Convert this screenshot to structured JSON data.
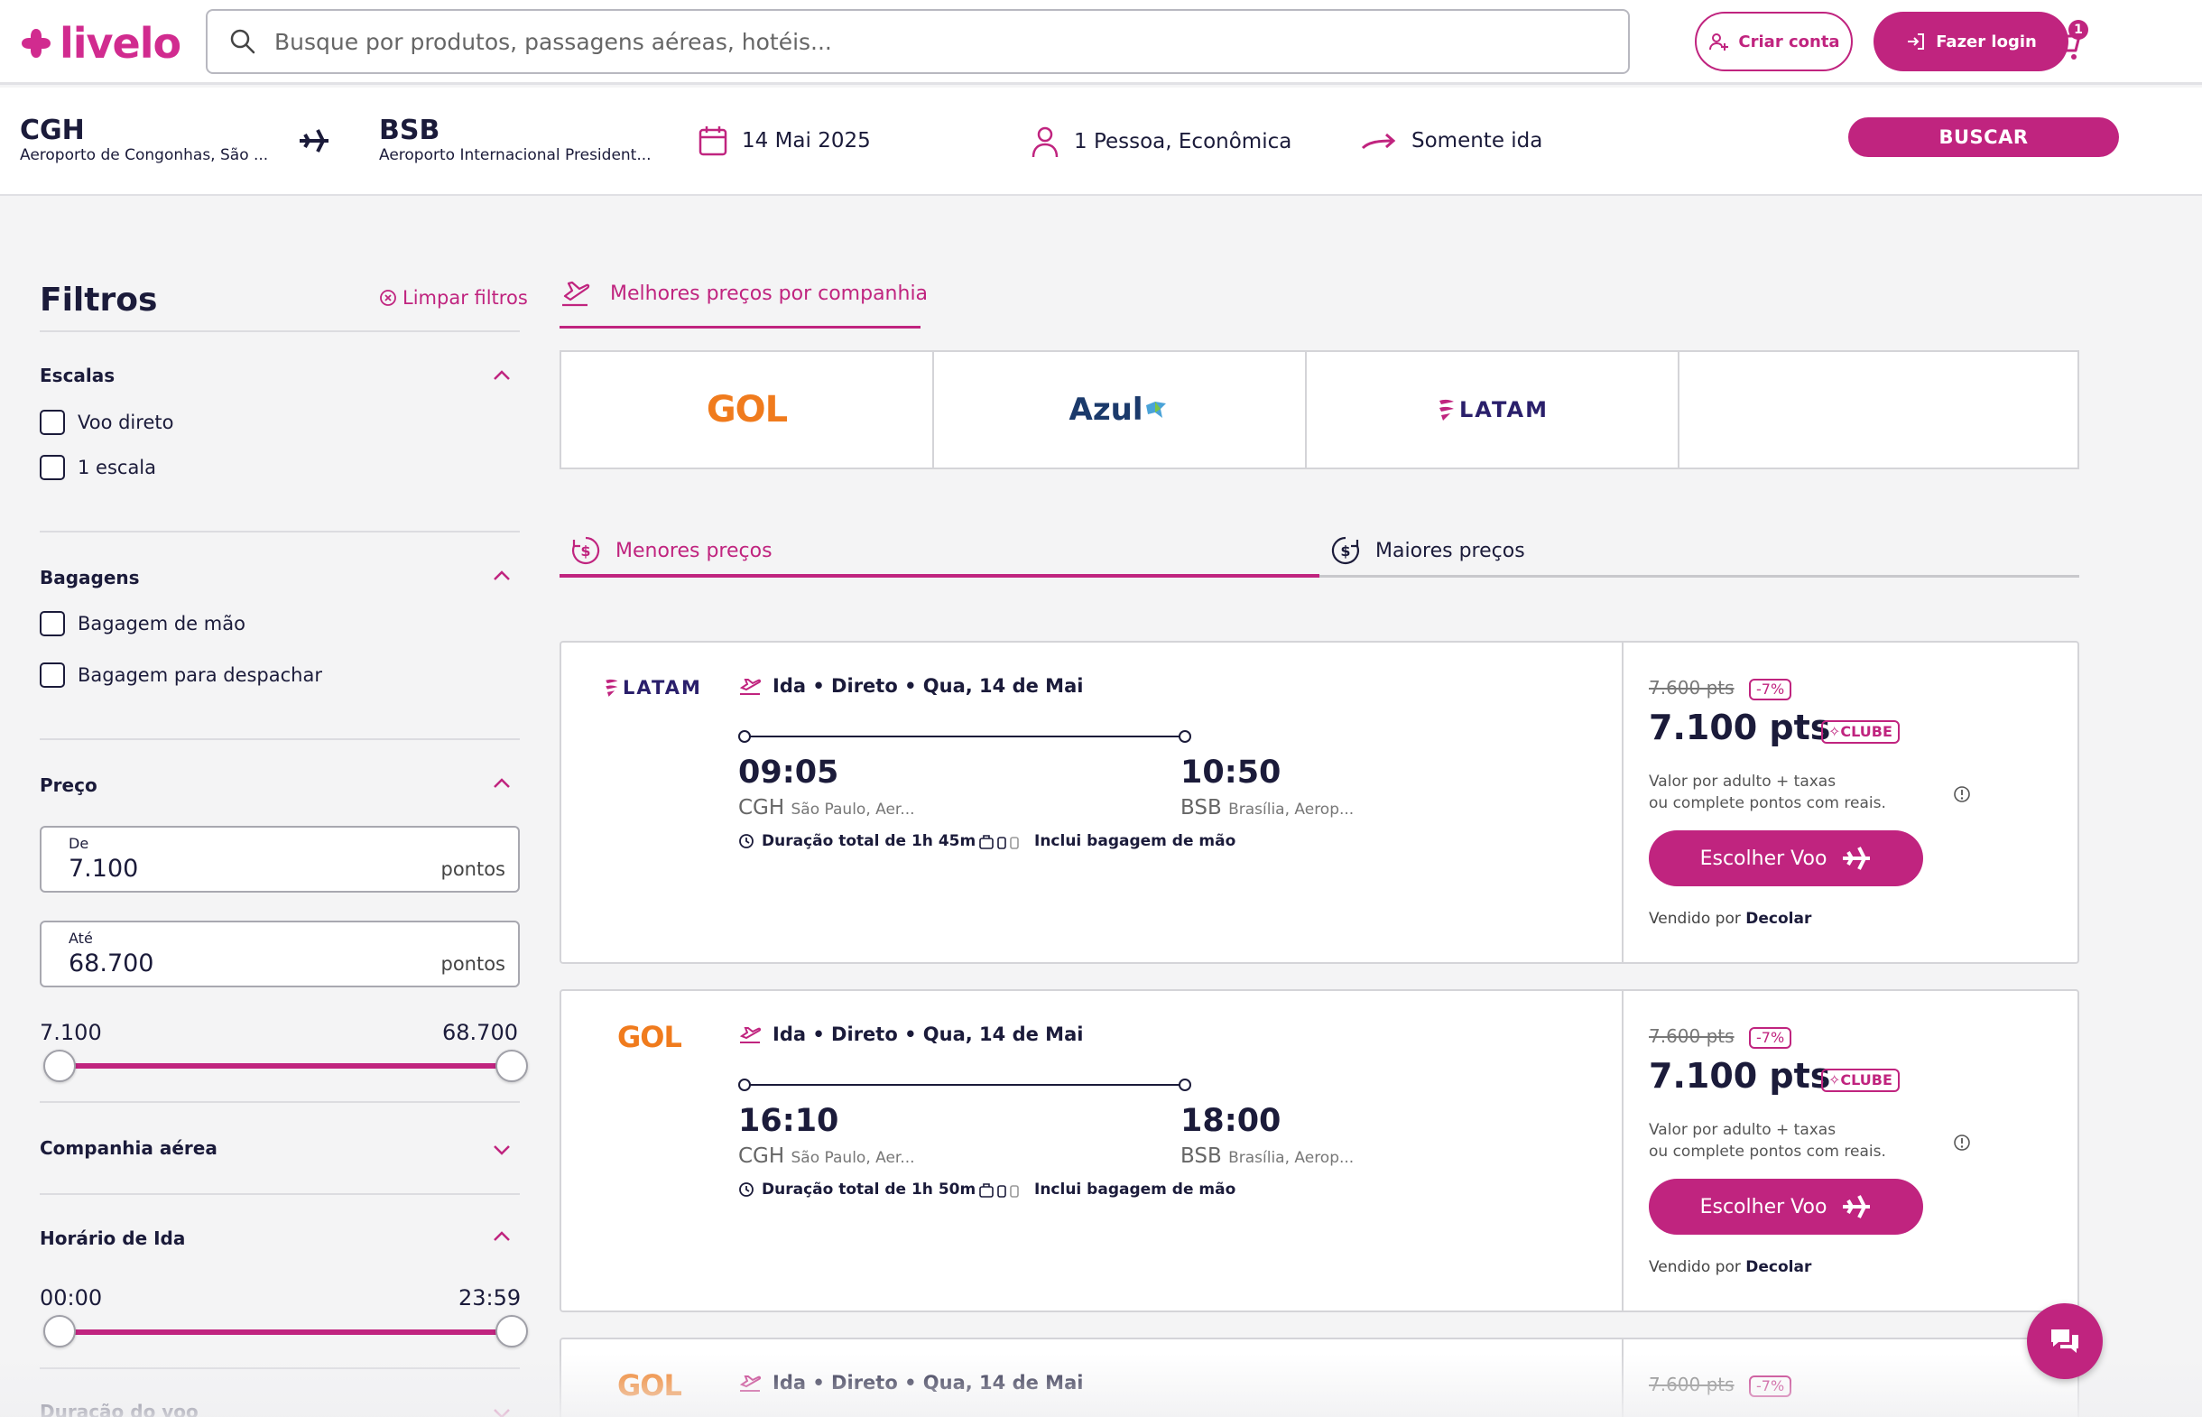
{
  "header": {
    "logo_text": "livelo",
    "search_placeholder": "Busque por produtos, passagens aéreas, hotéis...",
    "create_account": "Criar conta",
    "login": "Fazer login",
    "cart_count": "1"
  },
  "route": {
    "origin_code": "CGH",
    "origin_name": "Aeroporto de Congonhas, São ...",
    "dest_code": "BSB",
    "dest_name": "Aeroporto Internacional President...",
    "date": "14 Mai 2025",
    "passengers": "1 Pessoa, Econômica",
    "trip_type": "Somente ida",
    "search_button": "BUSCAR"
  },
  "filters": {
    "title": "Filtros",
    "clear": "Limpar filtros",
    "stops": {
      "title": "Escalas",
      "options": [
        "Voo direto",
        "1 escala"
      ]
    },
    "baggage": {
      "title": "Bagagens",
      "options": [
        "Bagagem de mão",
        "Bagagem para despachar"
      ]
    },
    "price": {
      "title": "Preço",
      "from_label": "De",
      "from_value": "7.100",
      "to_label": "Até",
      "to_value": "68.700",
      "unit": "pontos",
      "range_min": "7.100",
      "range_max": "68.700"
    },
    "airline": {
      "title": "Companhia aérea"
    },
    "departure_time": {
      "title": "Horário de Ida",
      "min": "00:00",
      "max": "23:59"
    },
    "duration": {
      "title": "Duração do voo"
    }
  },
  "main": {
    "best_prices_tab": "Melhores preços por companhia",
    "airlines": [
      "GOL",
      "Azul",
      "LATAM"
    ],
    "sort_tabs": [
      "Menores preços",
      "Maiores preços"
    ],
    "flights": [
      {
        "airline": "LATAM",
        "header": "Ida • Direto • Qua, 14 de Mai",
        "dep_time": "09:05",
        "dep_code": "CGH",
        "dep_city": "São Paulo, Aer...",
        "arr_time": "10:50",
        "arr_code": "BSB",
        "arr_city": "Brasília, Aerop...",
        "duration": "Duração total de 1h 45m",
        "baggage": "Inclui bagagem de mão",
        "old_price": "7.600 pts",
        "discount": "-7%",
        "price": "7.100 pts",
        "club": "CLUBE",
        "note_line1": "Valor por adulto + taxas",
        "note_line2": "ou complete pontos com reais.",
        "choose": "Escolher Voo",
        "sold_by_label": "Vendido por",
        "sold_by": "Decolar"
      },
      {
        "airline": "GOL",
        "header": "Ida • Direto • Qua, 14 de Mai",
        "dep_time": "16:10",
        "dep_code": "CGH",
        "dep_city": "São Paulo, Aer...",
        "arr_time": "18:00",
        "arr_code": "BSB",
        "arr_city": "Brasília, Aerop...",
        "duration": "Duração total de 1h 50m",
        "baggage": "Inclui bagagem de mão",
        "old_price": "7.600 pts",
        "discount": "-7%",
        "price": "7.100 pts",
        "club": "CLUBE",
        "note_line1": "Valor por adulto + taxas",
        "note_line2": "ou complete pontos com reais.",
        "choose": "Escolher Voo",
        "sold_by_label": "Vendido por",
        "sold_by": "Decolar"
      },
      {
        "airline": "GOL",
        "header": "Ida • Direto • Qua, 14 de Mai",
        "old_price": "7.600 pts",
        "discount": "-7%"
      }
    ]
  },
  "colors": {
    "brand": "#c0247f",
    "text": "#1b1b3a",
    "gol": "#f07b1d",
    "azul": "#1b3a6b",
    "latam": "#2a1f6b"
  }
}
